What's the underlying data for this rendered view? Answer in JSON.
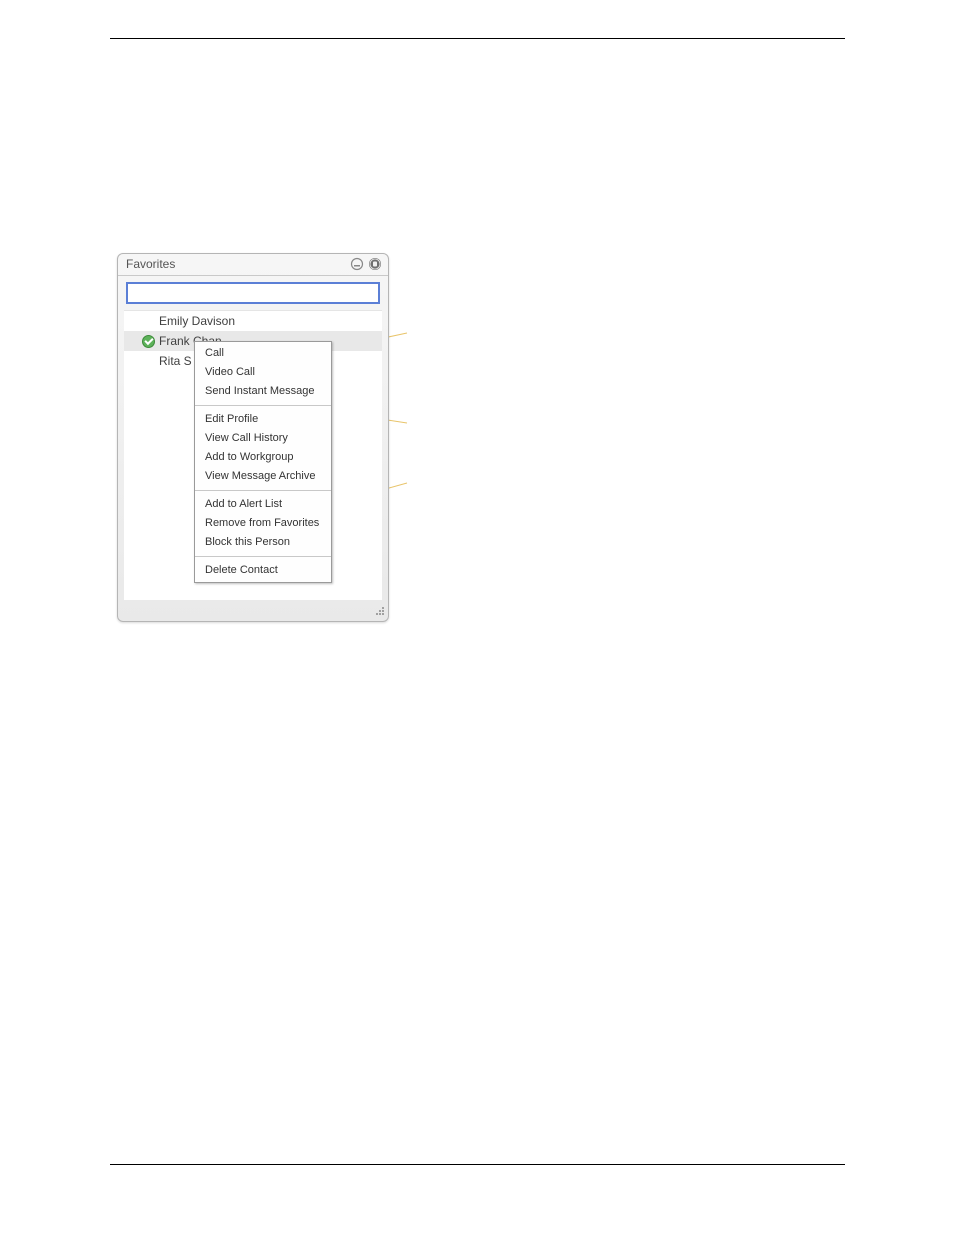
{
  "panel": {
    "title": "Favorites",
    "search_value": ""
  },
  "contacts": [
    {
      "name": "Emily Davison",
      "presence": "none",
      "selected": false
    },
    {
      "name": "Frank Chan",
      "presence": "online",
      "selected": true
    },
    {
      "name": "Rita S",
      "presence": "none",
      "selected": false
    }
  ],
  "context_menu": {
    "groups": [
      [
        "Call",
        "Video Call",
        "Send Instant Message"
      ],
      [
        "Edit Profile",
        "View Call History",
        "Add to Workgroup",
        "View Message Archive"
      ],
      [
        "Add to Alert List",
        "Remove from Favorites",
        "Block this Person"
      ],
      [
        "Delete Contact"
      ]
    ]
  }
}
